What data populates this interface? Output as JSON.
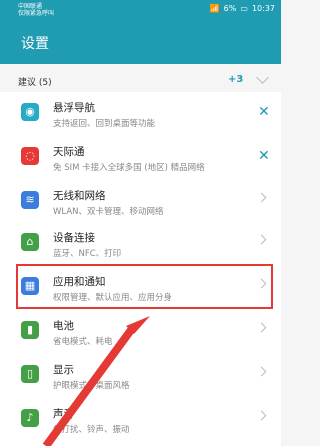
{
  "statusbar": {
    "carrier_line1": "中国联通",
    "carrier_line2": "仅限紧急呼叫",
    "battery_percent": "6%",
    "time": "10:37"
  },
  "header": {
    "title": "设置"
  },
  "suggestions": {
    "title": "建议 (5)",
    "count": "+3",
    "items": [
      {
        "label": "悬浮导航",
        "sub": "支持返回、回到桌面等功能",
        "icon": "floating-nav-icon",
        "color": "#28a9c4"
      },
      {
        "label": "天际通",
        "sub": "免 SIM 卡接入全球多国 (地区) 精品网络",
        "icon": "skylink-icon",
        "color": "#e53935"
      }
    ]
  },
  "settings": {
    "items": [
      {
        "label": "无线和网络",
        "sub": "WLAN、双卡管理、移动网络",
        "icon": "wifi-icon",
        "color": "#3b7ddd"
      },
      {
        "label": "设备连接",
        "sub": "蓝牙、NFC、打印",
        "icon": "device-connection-icon",
        "color": "#43a047"
      },
      {
        "label": "应用和通知",
        "sub": "权限管理、默认应用、应用分身",
        "icon": "apps-icon",
        "color": "#3b7ddd"
      },
      {
        "label": "电池",
        "sub": "省电模式、耗电",
        "icon": "battery-icon",
        "color": "#43a047"
      },
      {
        "label": "显示",
        "sub": "护眼模式、桌面风格",
        "icon": "display-icon",
        "color": "#43a047"
      },
      {
        "label": "声音",
        "sub": "免打扰、铃声、振动",
        "icon": "sound-icon",
        "color": "#43a047"
      }
    ]
  }
}
